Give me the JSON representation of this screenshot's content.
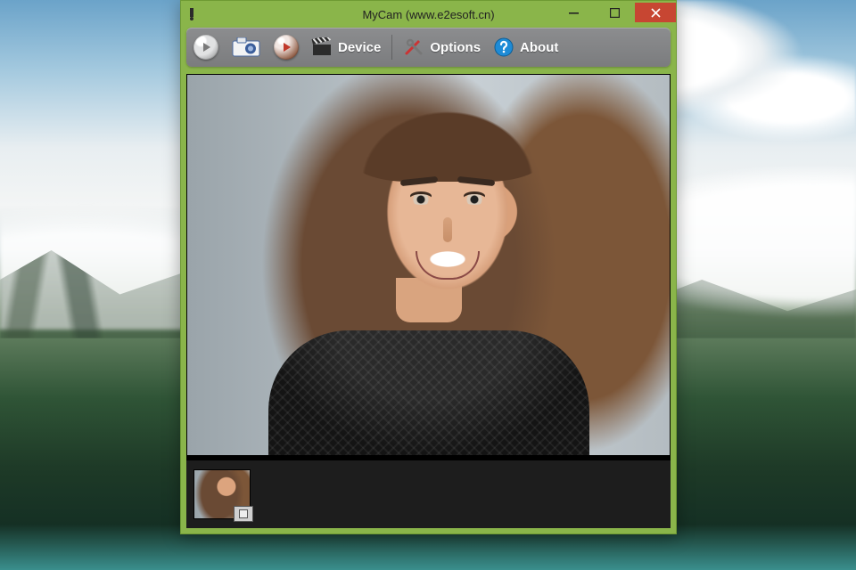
{
  "window": {
    "title": "MyCam (www.e2esoft.cn)"
  },
  "titlebar_icon": "app-icon",
  "win_controls": {
    "minimize": "minimize",
    "maximize": "maximize",
    "close": "close"
  },
  "toolbar": {
    "play_icon": "play-icon",
    "snapshot_icon": "camera-icon",
    "record_icon": "record-play-icon",
    "device": {
      "icon": "clapper-icon",
      "label": "Device"
    },
    "options": {
      "icon": "tools-icon",
      "label": "Options"
    },
    "about": {
      "icon": "help-icon",
      "label": "About"
    }
  },
  "preview": {
    "description": "Live webcam feed showing a smiling young woman with long brown hair against a light grey studio backdrop, wearing a sheer black mesh top."
  },
  "thumbnails": [
    {
      "name": "snapshot-1",
      "badge": "image-file"
    }
  ],
  "colors": {
    "window_chrome": "#8ab54a",
    "window_border": "#6e9a33",
    "close_button": "#c74632",
    "toolbar_bg": "#7f8082",
    "client_bg": "#111111"
  }
}
